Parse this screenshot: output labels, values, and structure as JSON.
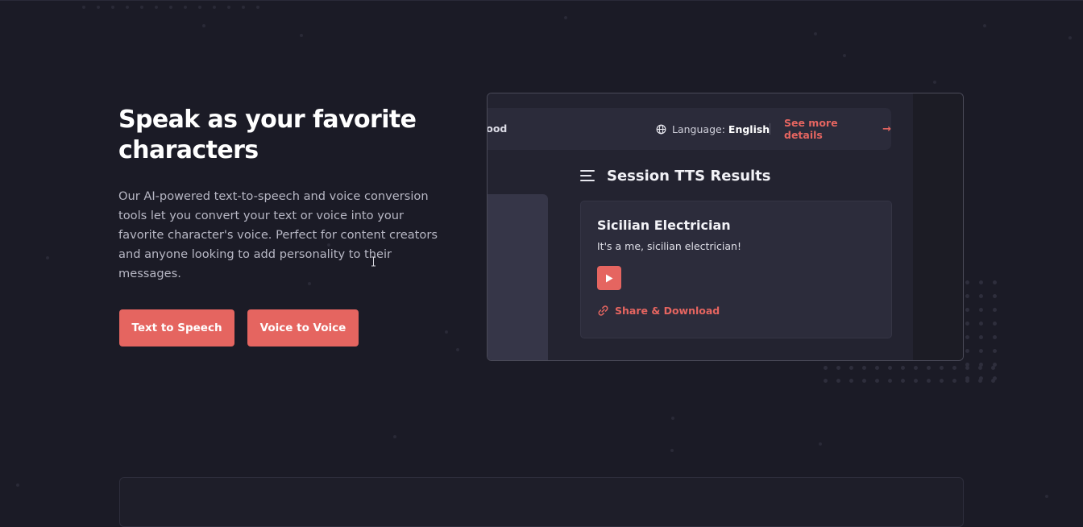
{
  "hero": {
    "title": "Speak as your favorite characters",
    "description": "Our AI-powered text-to-speech and voice conversion tools let you convert your text or voice into your favorite character's voice. Perfect for content creators and anyone looking to add personality to their messages.",
    "buttons": {
      "text_to_speech": "Text to Speech",
      "voice_to_voice": "Voice to Voice"
    }
  },
  "preview": {
    "topbar": {
      "truncated_label": "Good",
      "language_label": "Language:",
      "language_value": "English",
      "see_more": "See more details",
      "arrow": "→"
    },
    "results_heading": "Session TTS Results",
    "result_card": {
      "title": "Sicilian Electrician",
      "text": "It's a me, sicilian electrician!",
      "share_label": "Share & Download"
    }
  },
  "colors": {
    "accent": "#e56560",
    "background": "#1b1b26",
    "card": "#2c2c3b"
  },
  "icons": {
    "globe": "globe-icon",
    "menu": "menu-icon",
    "play": "play-icon",
    "link": "link-icon",
    "arrow": "arrow-right-icon"
  }
}
